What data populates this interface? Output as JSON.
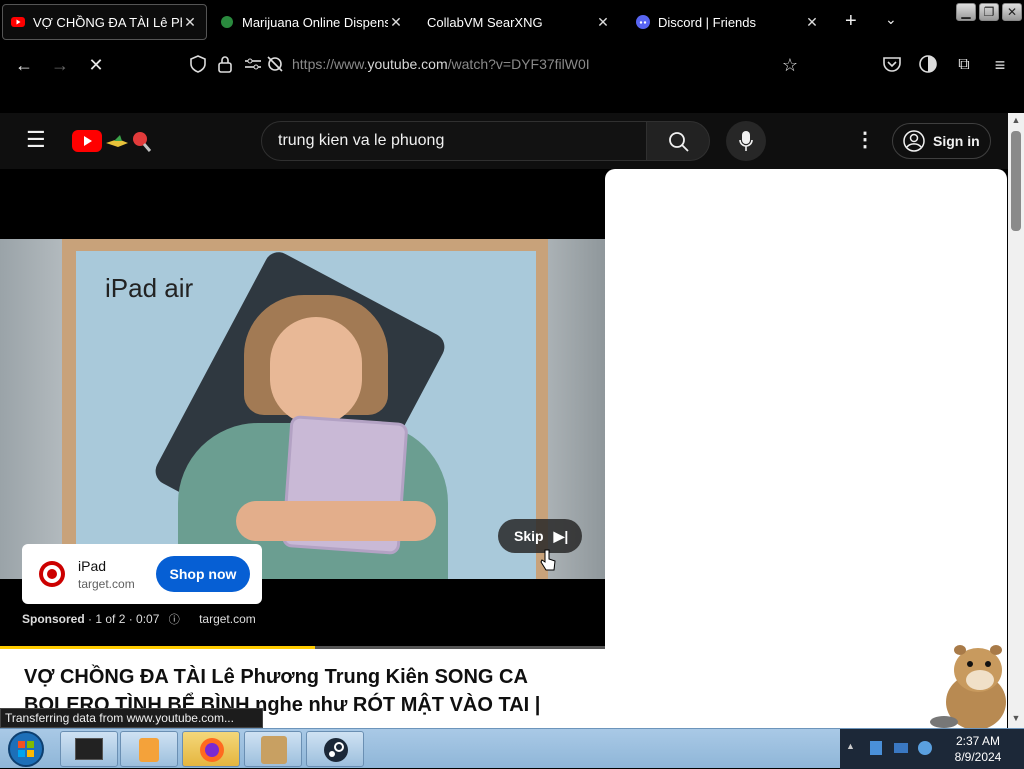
{
  "tabs": [
    {
      "title": "VỢ CHỒNG ĐA TÀI Lê Phươn",
      "favicon": "youtube-icon",
      "active": true
    },
    {
      "title": "Marijuana Online Dispensary",
      "favicon": "leaf-icon",
      "active": false
    },
    {
      "title": "CollabVM SearXNG",
      "favicon": "",
      "active": false
    },
    {
      "title": "Discord | Friends",
      "favicon": "discord-icon",
      "active": false
    }
  ],
  "url": {
    "prefix": "https://www.",
    "host": "youtube.com",
    "path": "/watch?v=DYF37filW0I"
  },
  "youtube": {
    "search_value": "trung kien va le phuong",
    "sign_in": "Sign in"
  },
  "ad": {
    "brand_text": "iPad air",
    "name": "iPad",
    "domain": "target.com",
    "shop_label": "Shop now",
    "skip_label": "Skip",
    "sponsored": "Sponsored",
    "meta": "· 1 of 2 · 0:07",
    "meta_domain": "target.com",
    "progress": 0.52
  },
  "video_title": "VỢ CHỒNG ĐA TÀI Lê Phương Trung Kiên SONG CA BOLERO TÌNH BỂ BÌNH nghe như RÓT MẬT VÀO TAI | THVL",
  "status_text": "Transferring data from www.youtube.com...",
  "clock": {
    "time": "2:37 AM",
    "date": "8/9/2024"
  },
  "colors": {
    "accent_shop": "#065fd4",
    "youtube_red": "#ff0000",
    "progress": "#ffcc00"
  }
}
